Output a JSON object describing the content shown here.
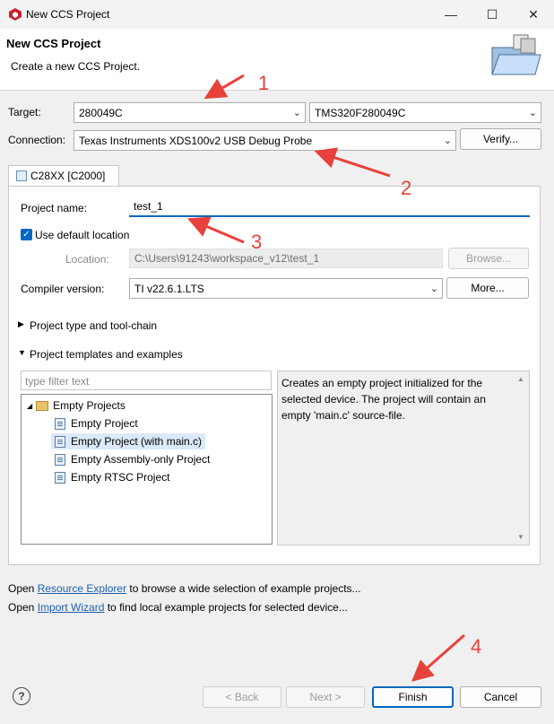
{
  "window": {
    "title": "New CCS Project"
  },
  "header": {
    "title": "New CCS Project",
    "subtitle": "Create a new CCS Project."
  },
  "target": {
    "label": "Target:",
    "family": "280049C",
    "device": "TMS320F280049C"
  },
  "connection": {
    "label": "Connection:",
    "value": "Texas Instruments XDS100v2 USB Debug Probe",
    "verify": "Verify..."
  },
  "tab": {
    "label": "C28XX [C2000]"
  },
  "project": {
    "name_label": "Project name:",
    "name_value": "test_1",
    "default_location_label": "Use default location",
    "default_location_checked": true,
    "location_label": "Location:",
    "location_value": "C:\\Users\\91243\\workspace_v12\\test_1",
    "browse": "Browse...",
    "compiler_label": "Compiler version:",
    "compiler_value": "TI v22.6.1.LTS",
    "more": "More..."
  },
  "sections": {
    "toolchain": "Project type and tool-chain",
    "templates": "Project templates and examples"
  },
  "filter": {
    "placeholder": "type filter text"
  },
  "tree": {
    "root": "Empty Projects",
    "items": [
      "Empty Project",
      "Empty Project (with main.c)",
      "Empty Assembly-only Project",
      "Empty RTSC Project"
    ],
    "selected_index": 1
  },
  "description": "Creates an empty project initialized for the selected device. The project will contain an empty 'main.c' source-file.",
  "footer": {
    "line1_pre": "Open ",
    "line1_link": "Resource Explorer",
    "line1_post": " to browse a wide selection of example projects...",
    "line2_pre": "Open ",
    "line2_link": "Import Wizard",
    "line2_post": " to find local example projects for selected device..."
  },
  "buttons": {
    "back": "< Back",
    "next": "Next >",
    "finish": "Finish",
    "cancel": "Cancel",
    "help": "?"
  },
  "annotations": [
    "1",
    "2",
    "3",
    "4"
  ],
  "colors": {
    "accent": "#0067c0",
    "annotation": "#e8403a",
    "selection": "#dbe9f8"
  },
  "icons": [
    "app-icon",
    "minimize-icon",
    "maximize-icon",
    "close-icon",
    "wizard-folder-icon",
    "checkbox-icon",
    "expand-arrow-icon",
    "folder-icon",
    "file-icon",
    "help-icon",
    "chevron-down-icon"
  ]
}
